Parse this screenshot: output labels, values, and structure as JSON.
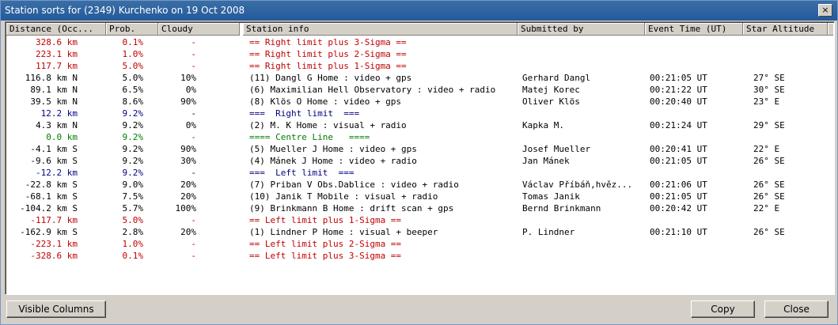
{
  "window": {
    "title": "Station sorts for (2349) Kurchenko on 19 Oct 2008",
    "close_glyph": "×"
  },
  "columns": [
    "Distance (Occ...",
    "Prob.",
    "Cloudy",
    "Station info",
    "Submitted by",
    "Event Time (UT)",
    "Star Altitude"
  ],
  "rows": [
    {
      "dist": "328.6 km",
      "prob": "0.1%",
      "cloudy": "-",
      "info": "== Right limit plus 3-Sigma ==",
      "by": "",
      "time": "",
      "alt": "",
      "color": "red"
    },
    {
      "dist": "223.1 km",
      "prob": "1.0%",
      "cloudy": "-",
      "info": "== Right limit plus 2-Sigma ==",
      "by": "",
      "time": "",
      "alt": "",
      "color": "red"
    },
    {
      "dist": "117.7 km",
      "prob": "5.0%",
      "cloudy": "-",
      "info": "== Right limit plus 1-Sigma ==",
      "by": "",
      "time": "",
      "alt": "",
      "color": "red"
    },
    {
      "dist": "116.8 km N",
      "prob": "5.0%",
      "cloudy": "10%",
      "info": "(11) Dangl G Home : video + gps",
      "by": "Gerhard Dangl",
      "time": "00:21:05 UT",
      "alt": "27° SE",
      "color": "black"
    },
    {
      "dist": "89.1 km N",
      "prob": "6.5%",
      "cloudy": "0%",
      "info": "(6) Maximilian Hell Observatory : video + radio",
      "by": "Matej Korec",
      "time": "00:21:22 UT",
      "alt": "30° SE",
      "color": "black"
    },
    {
      "dist": "39.5 km N",
      "prob": "8.6%",
      "cloudy": "90%",
      "info": "(8) Klös O Home : video + gps",
      "by": "Oliver Klös",
      "time": "00:20:40 UT",
      "alt": "23° E",
      "color": "black"
    },
    {
      "dist": "12.2 km",
      "prob": "9.2%",
      "cloudy": "-",
      "info": "===  Right limit  ===",
      "by": "",
      "time": "",
      "alt": "",
      "color": "blue"
    },
    {
      "dist": "4.3 km N",
      "prob": "9.2%",
      "cloudy": "0%",
      "info": "(2) M. K Home : visual + radio",
      "by": "Kapka M.",
      "time": "00:21:24 UT",
      "alt": "29° SE",
      "color": "black"
    },
    {
      "dist": "0.0 km",
      "prob": "9.2%",
      "cloudy": "-",
      "info": "==== Centre Line   ====",
      "by": "",
      "time": "",
      "alt": "",
      "color": "green"
    },
    {
      "dist": "-4.1 km S",
      "prob": "9.2%",
      "cloudy": "90%",
      "info": "(5) Mueller J Home : video + gps",
      "by": "Josef Mueller",
      "time": "00:20:41 UT",
      "alt": "22° E",
      "color": "black"
    },
    {
      "dist": "-9.6 km S",
      "prob": "9.2%",
      "cloudy": "30%",
      "info": "(4) Mánek J Home : video + radio",
      "by": "Jan Mánek",
      "time": "00:21:05 UT",
      "alt": "26° SE",
      "color": "black"
    },
    {
      "dist": "-12.2 km",
      "prob": "9.2%",
      "cloudy": "-",
      "info": "===  Left limit  ===",
      "by": "",
      "time": "",
      "alt": "",
      "color": "blue"
    },
    {
      "dist": "-22.8 km S",
      "prob": "9.0%",
      "cloudy": "20%",
      "info": "(7) Priban V Obs.Dablice : video + radio",
      "by": "Václav Příbáň,hvěz...",
      "time": "00:21:06 UT",
      "alt": "26° SE",
      "color": "black"
    },
    {
      "dist": "-68.1 km S",
      "prob": "7.5%",
      "cloudy": "20%",
      "info": "(10) Janik T Mobile : visual + radio",
      "by": "Tomas Janik",
      "time": "00:21:05 UT",
      "alt": "26° SE",
      "color": "black"
    },
    {
      "dist": "-104.2 km S",
      "prob": "5.7%",
      "cloudy": "100%",
      "info": "(9) Brinkmann B Home : drift scan + gps",
      "by": "Bernd Brinkmann",
      "time": "00:20:42 UT",
      "alt": "22° E",
      "color": "black"
    },
    {
      "dist": "-117.7 km",
      "prob": "5.0%",
      "cloudy": "-",
      "info": "== Left limit plus 1-Sigma ==",
      "by": "",
      "time": "",
      "alt": "",
      "color": "red"
    },
    {
      "dist": "-162.9 km S",
      "prob": "2.8%",
      "cloudy": "20%",
      "info": "(1) Lindner P Home : visual + beeper",
      "by": "P. Lindner",
      "time": "00:21:10 UT",
      "alt": "26° SE",
      "color": "black"
    },
    {
      "dist": "-223.1 km",
      "prob": "1.0%",
      "cloudy": "-",
      "info": "== Left limit plus 2-Sigma ==",
      "by": "",
      "time": "",
      "alt": "",
      "color": "red"
    },
    {
      "dist": "-328.6 km",
      "prob": "0.1%",
      "cloudy": "-",
      "info": "== Left limit plus 3-Sigma ==",
      "by": "",
      "time": "",
      "alt": "",
      "color": "red"
    }
  ],
  "buttons": {
    "visible_columns": "Visible Columns",
    "copy": "Copy",
    "close": "Close"
  }
}
